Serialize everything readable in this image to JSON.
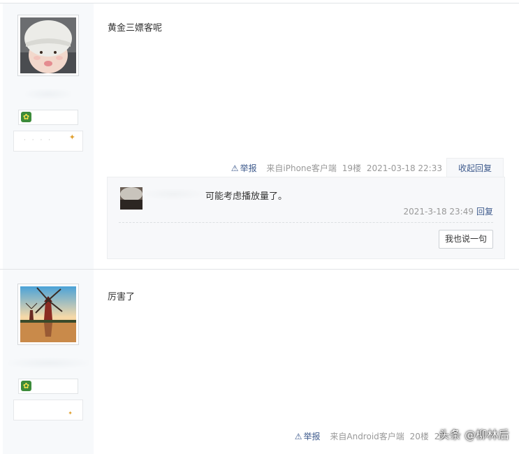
{
  "posts": [
    {
      "content": "黄金三嫖客呢",
      "report_label": "举报",
      "client": "来自iPhone客户端",
      "floor": "19楼",
      "time": "2021-03-18 22:33",
      "collapse_label": "收起回复",
      "reply": {
        "text": "可能考虑播放量了。",
        "time": "2021-3-18 23:49",
        "reply_label": "回复",
        "say_button": "我也说一句"
      }
    },
    {
      "content": "厉害了",
      "report_label": "举报",
      "client": "来自Android客户端",
      "floor": "20楼",
      "time": "20"
    }
  ],
  "watermark": "头条 @柳林后",
  "colors": {
    "link": "#3e5a8c",
    "meta_gray": "#999999",
    "author_bg": "#f7f9fb",
    "reply_bg": "#f7f8fa"
  },
  "icons": [
    "warning-icon",
    "level-badge-icon",
    "star-icon"
  ]
}
